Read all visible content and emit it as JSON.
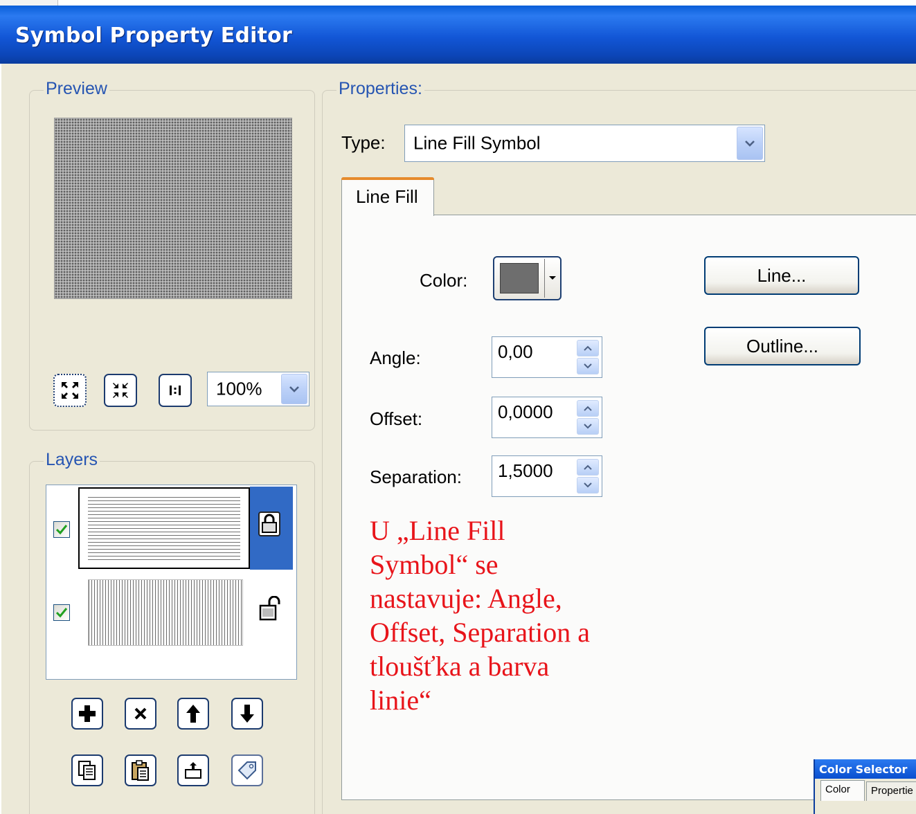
{
  "window": {
    "title": "Symbol Property Editor"
  },
  "preview": {
    "group_label": "Preview",
    "zoom_value": "100%"
  },
  "layers": {
    "group_label": "Layers",
    "items": [
      {
        "checked": true,
        "locked": true,
        "selected": true
      },
      {
        "checked": true,
        "locked": false,
        "selected": false
      }
    ]
  },
  "properties": {
    "group_label": "Properties:",
    "type_label": "Type:",
    "type_value": "Line Fill Symbol",
    "tab_label": "Line Fill",
    "color_label": "Color:",
    "color_value": "#6e6e6e",
    "angle_label": "Angle:",
    "angle_value": "0,00",
    "offset_label": "Offset:",
    "offset_value": "0,0000",
    "separation_label": "Separation:",
    "separation_value": "1,5000",
    "line_button": "Line...",
    "outline_button": "Outline..."
  },
  "annotation": {
    "lines": [
      "U „Line Fill",
      "Symbol“ se",
      "nastavuje: Angle,",
      "Offset, Separation a",
      "tloušťka a barva",
      "linie“"
    ],
    "color": "#e8141a"
  },
  "color_selector": {
    "title": "Color Selector",
    "tabs": [
      "Color",
      "Propertie"
    ]
  }
}
